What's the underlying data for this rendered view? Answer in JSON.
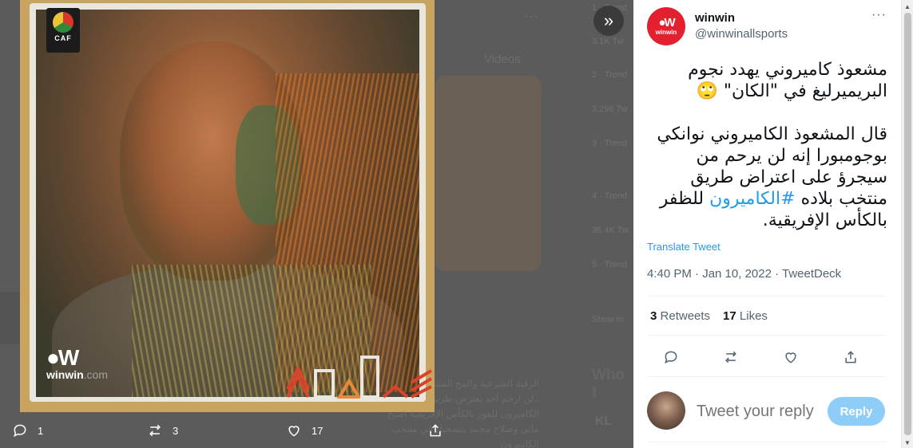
{
  "background": {
    "videos_label": "Videos",
    "who_to_follow_label": "Who t",
    "trending": [
      "1 · Trend",
      "3.1K Tw",
      "2 · Trend",
      "3,296 Tw",
      "3 · Trend",
      "4 · Trend",
      "36.4K Tw",
      "5 · Trend",
      "Show m"
    ],
    "arabic_snippet": "الرقية الشرعية والمح المشعوذ الكاميرونيا ..لن ارحم أحد يعترض طريق بلادي الكاميرون للفوز بالكأس الإفريقية أصبح مانى وصلاح محمد بتسجيل في منتخب الكاميرون",
    "kl_text": "KL"
  },
  "media": {
    "caf_logo_text": "CAF",
    "brand_text": "winwin",
    "brand_suffix": ".com",
    "expand_icon": "chevron-double-right-icon"
  },
  "media_actions": {
    "replies": "1",
    "retweets": "3",
    "likes": "17"
  },
  "tweet": {
    "author_name": "winwin",
    "handle": "@winwinallsports",
    "avatar_text": "winwin",
    "more_icon": "more-horizontal-icon",
    "paragraph_1": "مشعوذ كاميروني يهدد نجوم البريميرليغ في \"الكان\" 🙄",
    "paragraph_2_prefix": "قال المشعوذ الكاميروني نوانكي بوجومبورا إنه لن يرحم من سيجرؤ على اعتراض طريق منتخب بلاده",
    "hashtag": "#الكاميرون",
    "paragraph_2_suffix": "للظفر بالكأس الإفريقية.",
    "translate_label": "Translate Tweet",
    "timestamp": "4:40 PM · Jan 10, 2022 · TweetDeck",
    "retweet_count": "3",
    "retweet_label": "Retweets",
    "like_count": "17",
    "like_label": "Likes"
  },
  "reply": {
    "placeholder": "Tweet your reply",
    "button_label": "Reply"
  },
  "colors": {
    "accent": "#1d9bf0",
    "brand_red": "#e5202e",
    "reply_button": "#8ecdf8"
  }
}
